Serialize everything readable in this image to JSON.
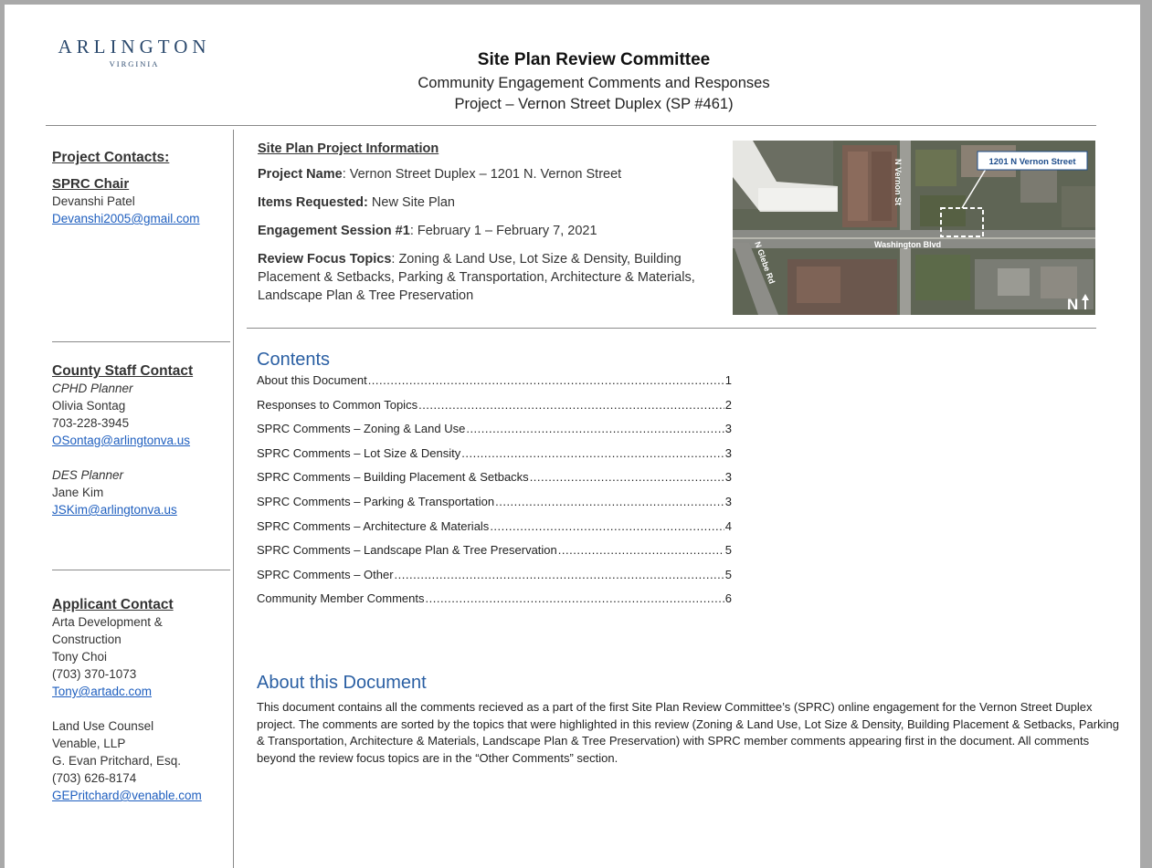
{
  "logo": {
    "main": "ARLINGTON",
    "sub": "VIRGINIA"
  },
  "header": {
    "title": "Site Plan Review Committee",
    "subtitle": "Community Engagement Comments and Responses",
    "project": "Project – Vernon Street Duplex (SP #461)"
  },
  "sidebar": {
    "project_contacts": {
      "heading": "Project Contacts:",
      "chair_label": "SPRC Chair",
      "chair_name": "Devanshi Patel",
      "chair_email": "Devanshi2005@gmail.com"
    },
    "county_staff": {
      "heading": "County Staff Contact",
      "cphd_role": "CPHD Planner",
      "cphd_name": "Olivia Sontag",
      "cphd_phone": "703-228-3945",
      "cphd_email": "OSontag@arlingtonva.us",
      "des_role": "DES Planner",
      "des_name": "Jane Kim",
      "des_email": "JSKim@arlingtonva.us"
    },
    "applicant": {
      "heading": "Applicant Contact",
      "company_line1": "Arta Development &",
      "company_line2": "Construction",
      "name": "Tony Choi",
      "phone": "(703) 370-1073",
      "email": "Tony@artadc.com",
      "counsel_label": "Land Use Counsel",
      "counsel_firm": "Venable, LLP",
      "counsel_name": "G. Evan Pritchard, Esq.",
      "counsel_phone": "(703) 626-8174",
      "counsel_email": "GEPritchard@venable.com"
    }
  },
  "project_info": {
    "title": "Site Plan Project Information",
    "name_label": "Project Name",
    "name_value": ": Vernon Street Duplex – 1201 N. Vernon Street",
    "items_label": "Items Requested:",
    "items_value": " New Site Plan",
    "session_label": "Engagement Session #1",
    "session_value": ": February 1 – February 7, 2021",
    "focus_label": "Review Focus Topics",
    "focus_value": ": Zoning & Land Use, Lot Size & Density, Building Placement & Setbacks, Parking & Transportation, Architecture & Materials, Landscape Plan & Tree Preservation"
  },
  "map": {
    "callout": "1201 N Vernon Street",
    "street_vernon": "N Vernon St",
    "street_washington": "Washington Blvd",
    "street_glebe": "N Glebe Rd",
    "north": "N"
  },
  "contents": {
    "title": "Contents",
    "items": [
      {
        "label": "About this Document",
        "page": "1"
      },
      {
        "label": "Responses to Common Topics",
        "page": "2"
      },
      {
        "label": "SPRC Comments – Zoning & Land Use",
        "page": "3"
      },
      {
        "label": "SPRC Comments – Lot Size & Density",
        "page": "3"
      },
      {
        "label": "SPRC Comments – Building Placement & Setbacks",
        "page": "3"
      },
      {
        "label": "SPRC Comments – Parking & Transportation",
        "page": "3"
      },
      {
        "label": "SPRC Comments – Architecture & Materials",
        "page": "4"
      },
      {
        "label": "SPRC Comments – Landscape Plan & Tree Preservation",
        "page": "5"
      },
      {
        "label": "SPRC Comments – Other",
        "page": "5"
      },
      {
        "label": "Community Member Comments",
        "page": "6"
      }
    ]
  },
  "about": {
    "title": "About this Document",
    "body": "This document contains all the comments recieved as a part of the first Site Plan Review Committee’s (SPRC) online engagement for the Vernon Street Duplex project. The comments are sorted by the topics that were highlighted in this review (Zoning & Land Use, Lot Size & Density, Building Placement & Setbacks, Parking & Transportation, Architecture & Materials, Landscape Plan & Tree Preservation) with SPRC member comments appearing first in the document. All comments beyond the review focus topics are in the “Other Comments” section."
  },
  "colors": {
    "heading_blue": "#2a5fa3",
    "link_blue": "#1f5fbf",
    "logo_navy": "#2c4a6e"
  }
}
